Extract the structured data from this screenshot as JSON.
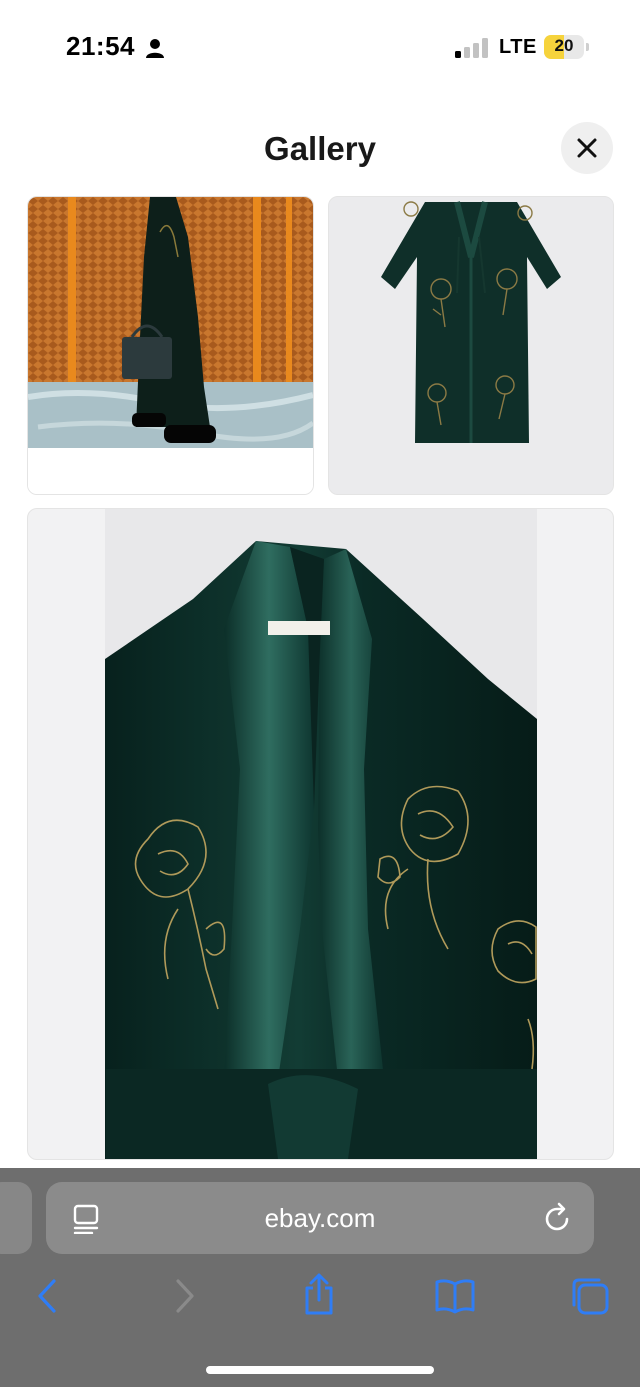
{
  "status_bar": {
    "time": "21:54",
    "network": "LTE",
    "battery_level": "20",
    "battery_fraction": 0.2,
    "signal_bars_active": 1,
    "signal_bars_total": 4,
    "icons": [
      "person-icon",
      "signal-icon"
    ]
  },
  "gallery": {
    "title": "Gallery",
    "close_icon": "close-icon",
    "images": [
      {
        "name": "gallery-image-model-street"
      },
      {
        "name": "gallery-image-robe-front"
      },
      {
        "name": "gallery-image-robe-detail"
      }
    ]
  },
  "browser": {
    "url": "ebay.com",
    "icons": [
      "reader-icon",
      "reload-icon",
      "back-icon",
      "forward-icon",
      "share-icon",
      "bookmarks-icon",
      "tabs-icon"
    ],
    "accent_color": "#2f7df6",
    "disabled_color": "#8a8a8a"
  }
}
